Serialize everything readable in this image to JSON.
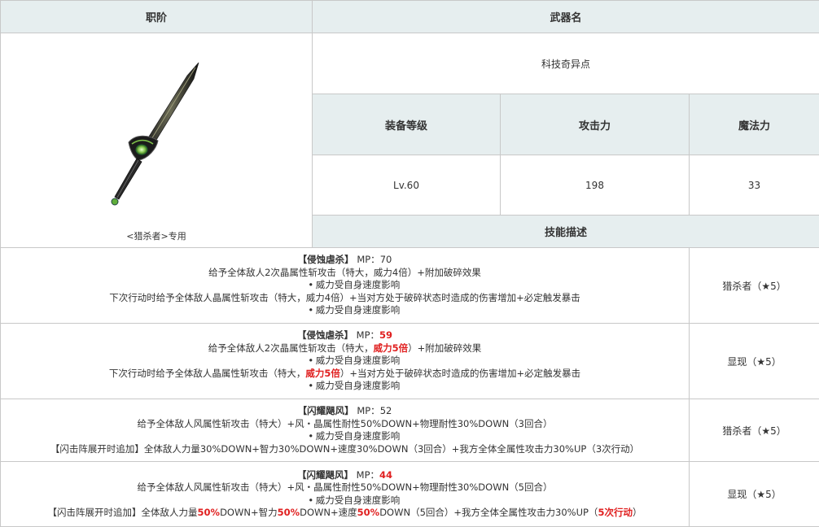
{
  "headers": {
    "job": "职阶",
    "weapon_name": "武器名",
    "equip_level": "装备等级",
    "attack": "攻击力",
    "magic": "魔法力",
    "skill_desc": "技能描述",
    "job2": "职阶"
  },
  "weapon": {
    "name": "科技奇异点",
    "caption": "<猎杀者>专用",
    "icon": "sword-icon",
    "level": "Lv.60",
    "attack": "198",
    "magic": "33"
  },
  "skills": [
    {
      "head": {
        "name": "【侵蚀虐杀】",
        "mp_label": "MP：",
        "mp": "70"
      },
      "l2": "给予全体敌人2次晶属性斩攻击（特大，威力4倍）+附加破碎效果",
      "l3": "威力受自身速度影响",
      "l4": "下次行动时给予全体敌人晶属性斩攻击（特大，威力4倍）+当对方处于破碎状态时造成的伤害增加+必定触发暴击",
      "l5": "威力受自身速度影响",
      "job": "猎杀者（★5）"
    },
    {
      "head": {
        "name": "【侵蚀虐杀】",
        "mp_label": "MP：",
        "mp": "59"
      },
      "l2a": "给予全体敌人2次晶属性斩攻击（特大，",
      "l2r": "威力5倍",
      "l2b": "）+附加破碎效果",
      "l3": "威力受自身速度影响",
      "l4a": "下次行动时给予全体敌人晶属性斩攻击（特大，",
      "l4r": "威力5倍",
      "l4b": "）+当对方处于破碎状态时造成的伤害增加+必定触发暴击",
      "l5": "威力受自身速度影响",
      "job": "显现（★5）"
    },
    {
      "head": {
        "name": "【闪耀飓风】",
        "mp_label": "MP：",
        "mp": "52"
      },
      "l2": "给予全体敌人风属性斩攻击（特大）+风・晶属性耐性50%DOWN+物理耐性30%DOWN（3回合）",
      "l3": "威力受自身速度影响",
      "l4": "【闪击阵展开时追加】全体敌人力量30%DOWN+智力30%DOWN+速度30%DOWN（3回合）+我方全体全属性攻击力30%UP（3次行动）",
      "job": "猎杀者（★5）"
    },
    {
      "head": {
        "name": "【闪耀飓风】",
        "mp_label": "MP：",
        "mp": "44"
      },
      "l2": "给予全体敌人风属性斩攻击（特大）+风・晶属性耐性50%DOWN+物理耐性30%DOWN（5回合）",
      "l3": "威力受自身速度影响",
      "l4_1": "【闪击阵展开时追加】全体敌人力量",
      "l4_r1": "50%",
      "l4_2": "DOWN+智力",
      "l4_r2": "50%",
      "l4_3": "DOWN+速度",
      "l4_r3": "50%",
      "l4_4": "DOWN（5回合）+我方全体全属性攻击力30%UP（",
      "l4_r4": "5次行动",
      "l4_5": "）",
      "job": "显现（★5）"
    }
  ]
}
